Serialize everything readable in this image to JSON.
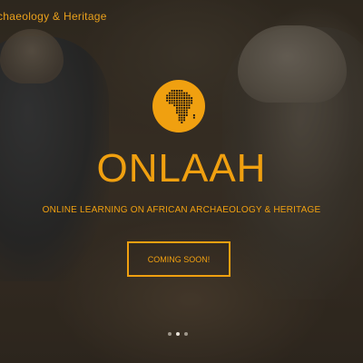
{
  "header": {
    "brand_text": "chaeology & Heritage"
  },
  "hero": {
    "logo_icon": "africa-dots-icon",
    "title": "ONLAAH",
    "subtitle": "ONLINE LEARNING ON AFRICAN ARCHAEOLOGY & HERITAGE",
    "cta_label": "COMING SOON!",
    "slides": [
      {
        "active": false
      },
      {
        "active": true
      },
      {
        "active": false
      }
    ]
  },
  "colors": {
    "accent": "#f0a010",
    "logo_dots": "#1a1410"
  }
}
